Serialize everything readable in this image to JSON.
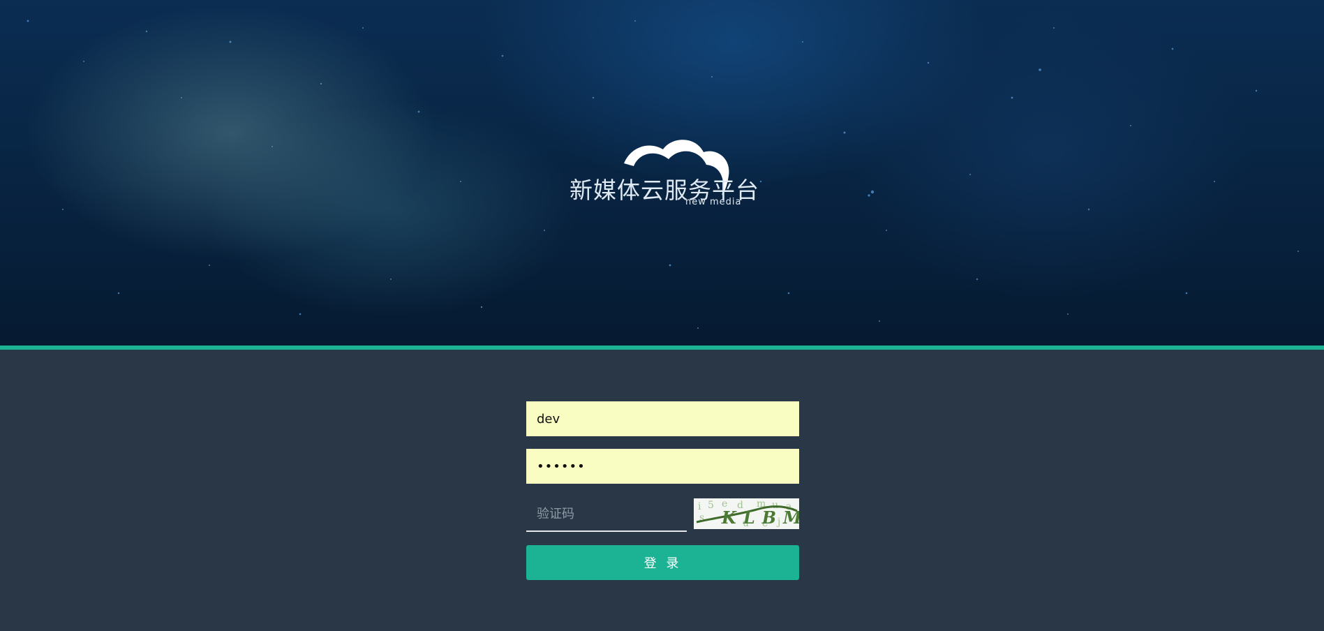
{
  "brand": {
    "title": "新媒体云服务平台",
    "subtitle": "new media"
  },
  "login": {
    "username_value": "dev",
    "password_value": "••••••",
    "captcha_placeholder": "验证码",
    "captcha_text": "KLBM",
    "submit_label": "登 录"
  },
  "colors": {
    "accent": "#1bb394",
    "panel_bg": "#293746",
    "input_bg": "#fafdc2"
  }
}
